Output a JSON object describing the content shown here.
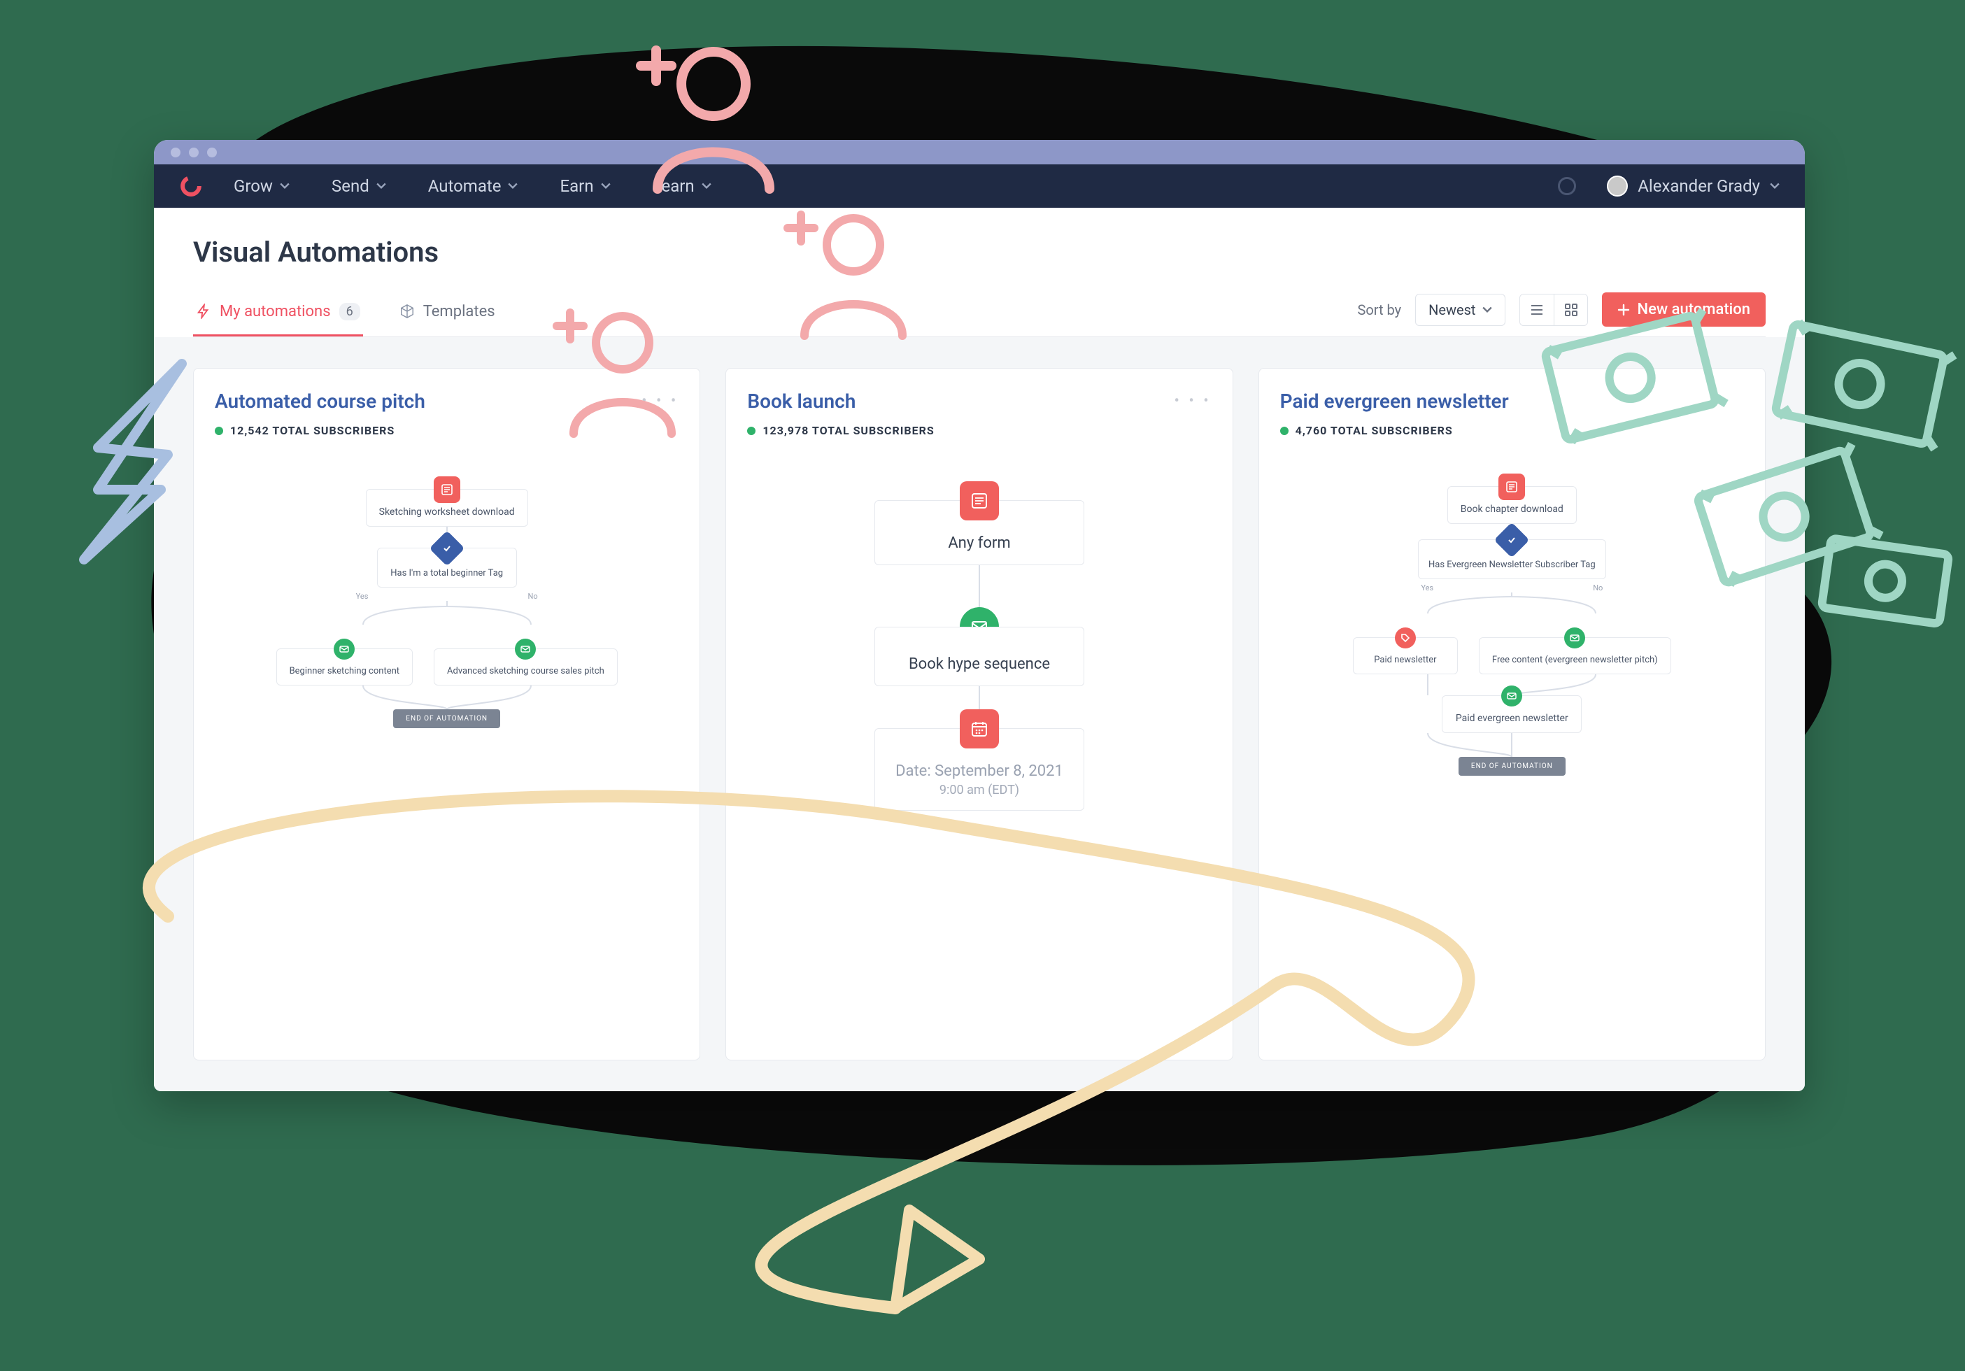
{
  "topnav": {
    "items": [
      "Grow",
      "Send",
      "Automate",
      "Earn",
      "Learn"
    ],
    "user_name": "Alexander Grady"
  },
  "page": {
    "title": "Visual Automations"
  },
  "tabs": {
    "my_label": "My automations",
    "my_count": "6",
    "templates_label": "Templates"
  },
  "controls": {
    "sort_label": "Sort by",
    "sort_value": "Newest",
    "new_button": "New automation"
  },
  "cards": [
    {
      "title": "Automated course pitch",
      "subscribers": "12,542 TOTAL SUBSCRIBERS",
      "flow": {
        "start": "Sketching worksheet download",
        "condition": "Has I'm a total beginner Tag",
        "yes": "Yes",
        "no": "No",
        "branch_left": "Beginner sketching content",
        "branch_right": "Advanced sketching course sales pitch",
        "end": "END OF AUTOMATION"
      }
    },
    {
      "title": "Book launch",
      "subscribers": "123,978 TOTAL SUBSCRIBERS",
      "flow": {
        "start": "Any form",
        "sequence": "Book hype sequence",
        "date_label": "Date: September 8, 2021",
        "date_time": "9:00 am (EDT)"
      }
    },
    {
      "title": "Paid evergreen newsletter",
      "subscribers": "4,760 TOTAL SUBSCRIBERS",
      "flow": {
        "start": "Book chapter download",
        "condition": "Has Evergreen Newsletter Subscriber Tag",
        "yes": "Yes",
        "no": "No",
        "branch_left": "Paid newsletter",
        "branch_right": "Free content (evergreen newsletter pitch)",
        "sub_node": "Paid evergreen newsletter",
        "end": "END OF AUTOMATION"
      }
    }
  ]
}
